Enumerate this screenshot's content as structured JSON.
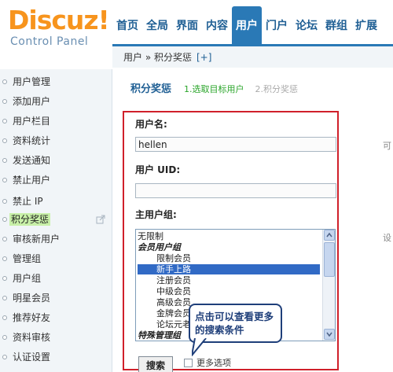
{
  "logo": {
    "brand": "Discuz!",
    "sub": "Control Panel"
  },
  "topnav": [
    {
      "label": "首页",
      "active": false
    },
    {
      "label": "全局",
      "active": false
    },
    {
      "label": "界面",
      "active": false
    },
    {
      "label": "内容",
      "active": false
    },
    {
      "label": "用户",
      "active": true
    },
    {
      "label": "门户",
      "active": false
    },
    {
      "label": "论坛",
      "active": false
    },
    {
      "label": "群组",
      "active": false
    },
    {
      "label": "扩展",
      "active": false
    }
  ],
  "breadcrumb": {
    "text": "用户 » 积分奖惩",
    "add": "[+]"
  },
  "sidebar": [
    "用户管理",
    "添加用户",
    "用户栏目",
    "资料统计",
    "发送通知",
    "禁止用户",
    "禁止 IP",
    "积分奖惩",
    "审核新用户",
    "管理组",
    "用户组",
    "明星会员",
    "推荐好友",
    "资料审核",
    "认证设置"
  ],
  "sidebar_active": "积分奖惩",
  "steps": {
    "title": "积分奖惩",
    "step1": "1.选取目标用户",
    "step2": "2.积分奖惩"
  },
  "form": {
    "username_label": "用户名:",
    "username_value": "hellen",
    "uid_label": "用户 UID:",
    "uid_value": "",
    "group_label": "主用户组:",
    "search_button": "搜索",
    "more_options": "更多选项"
  },
  "group_options": [
    {
      "label": "无限制",
      "kind": "opt"
    },
    {
      "label": "会员用户组",
      "kind": "grp"
    },
    {
      "label": "限制会员",
      "kind": "ind"
    },
    {
      "label": "新手上路",
      "kind": "ind",
      "selected": true
    },
    {
      "label": "注册会员",
      "kind": "ind"
    },
    {
      "label": "中级会员",
      "kind": "ind"
    },
    {
      "label": "高级会员",
      "kind": "ind"
    },
    {
      "label": "金牌会员",
      "kind": "ind"
    },
    {
      "label": "论坛元老",
      "kind": "ind"
    },
    {
      "label": "特殊管理组",
      "kind": "grp"
    }
  ],
  "side_notes": {
    "n1": "可",
    "n2": "设"
  },
  "callout": {
    "text": "点击可以查看更多的搜索条件"
  },
  "colors": {
    "accent": "#2a79b6",
    "logo": "#f7941d",
    "highlight_border": "#d0202a",
    "active_side": "#c8f0a8"
  }
}
